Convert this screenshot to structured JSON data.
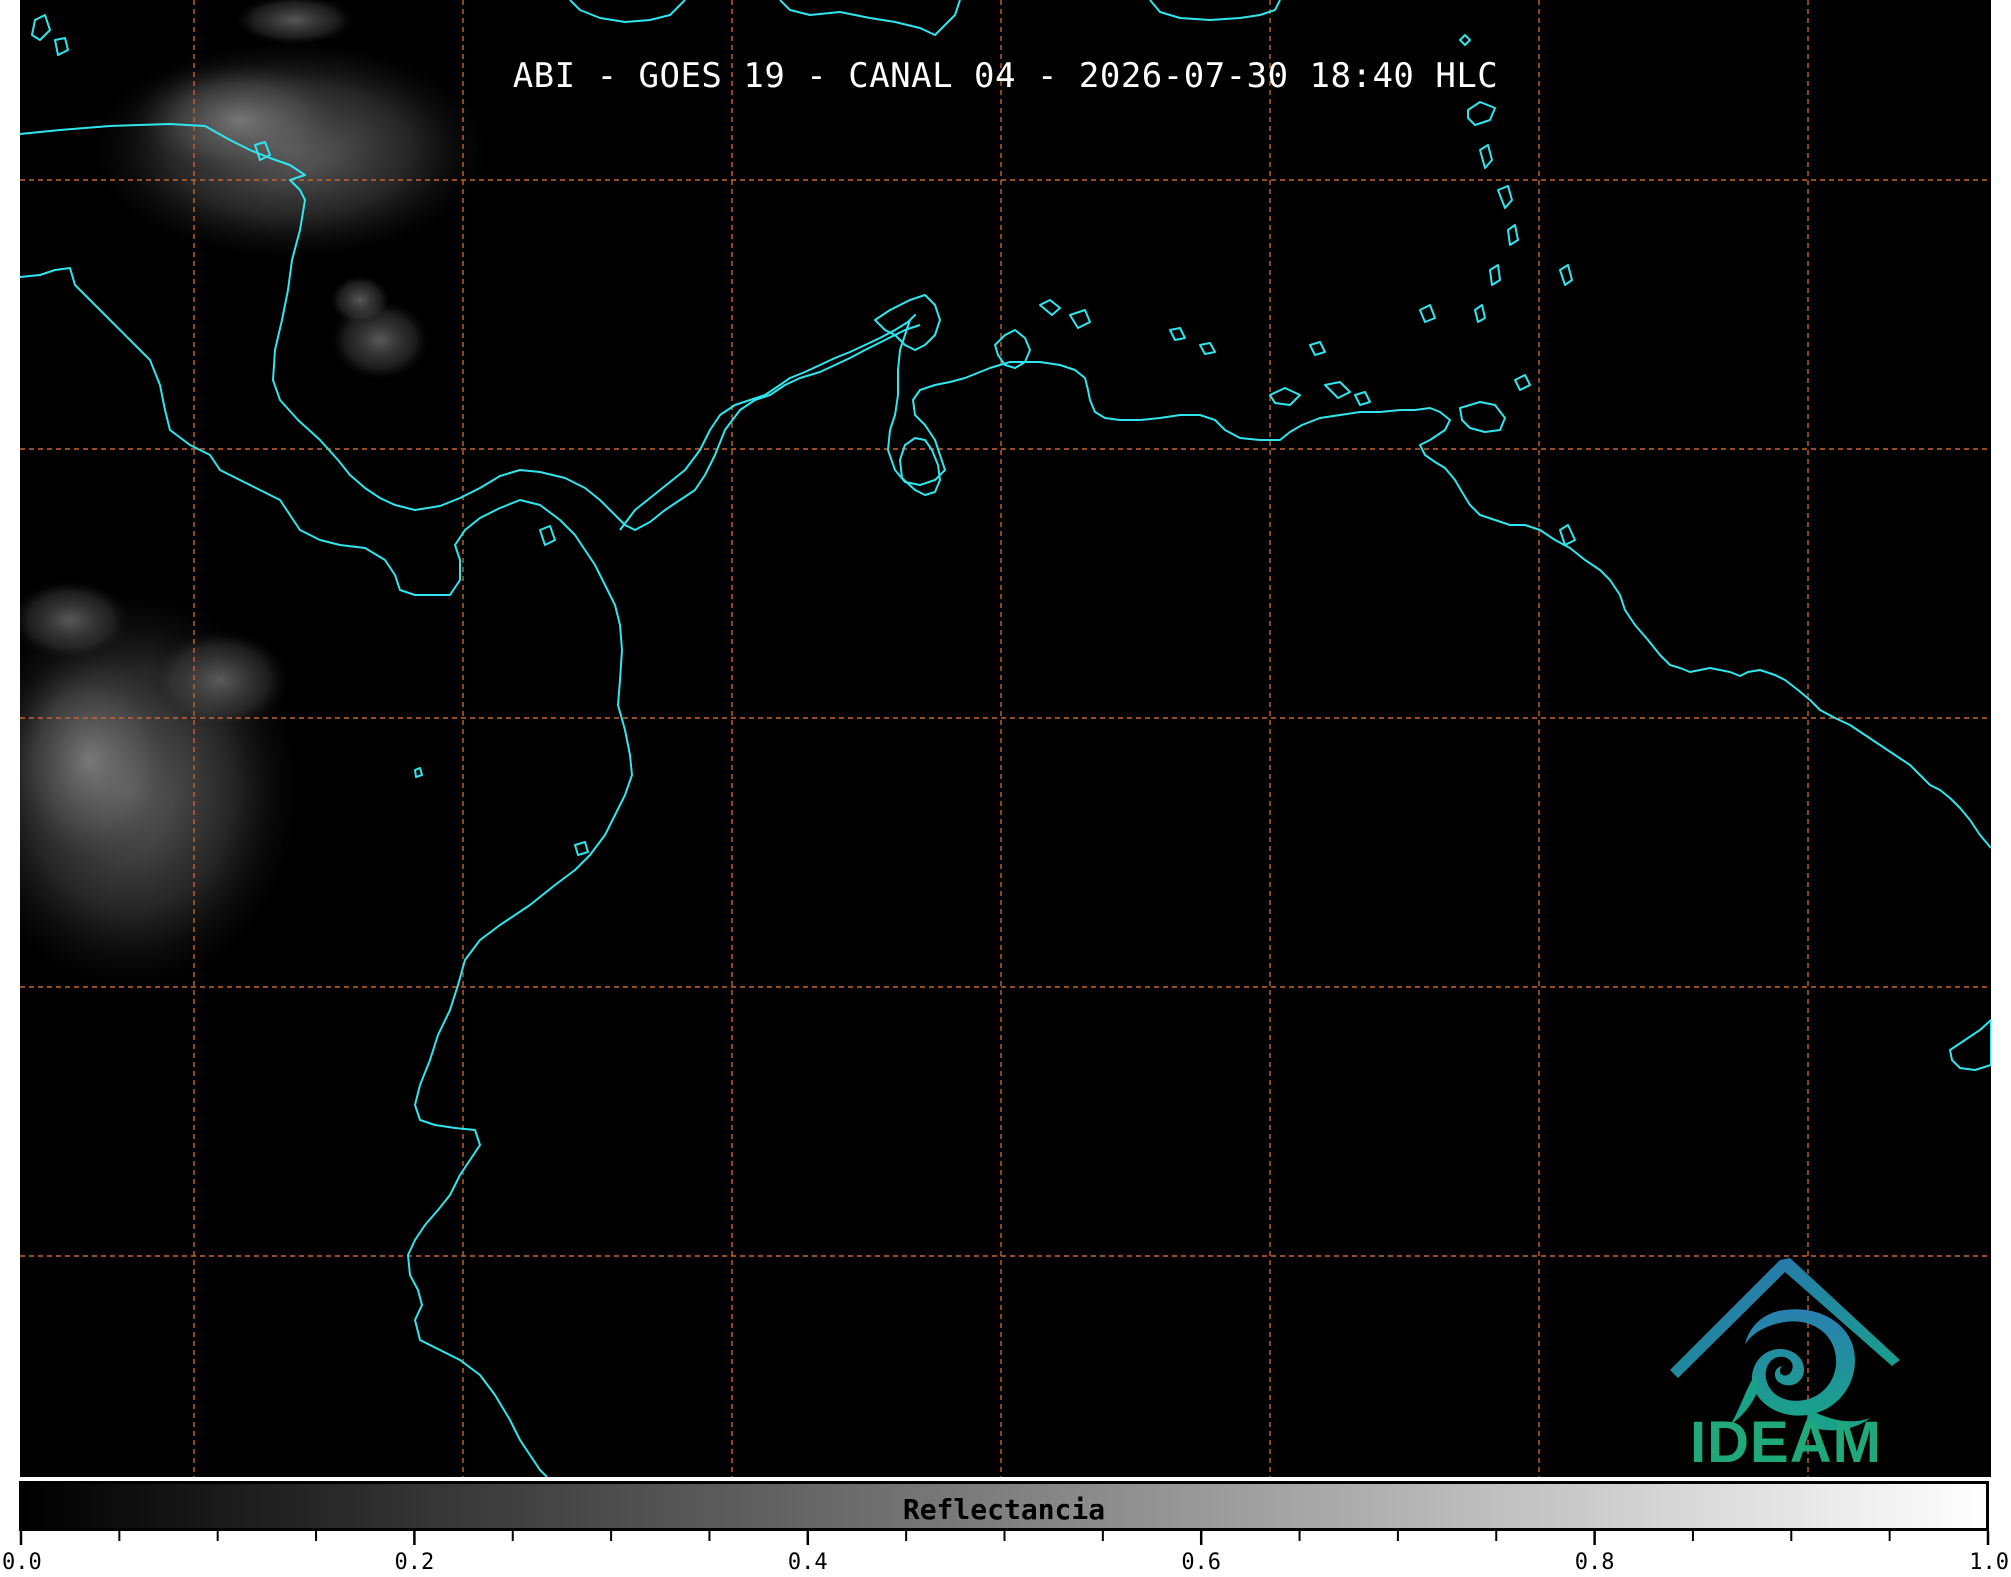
{
  "title": "ABI - GOES 19 - CANAL 04 - 2026-07-30 18:40 HLC",
  "colorbar": {
    "label": "Reflectancia",
    "range": [
      0.0,
      1.0
    ],
    "major_ticks": [
      0.0,
      0.2,
      0.4,
      0.6,
      0.8,
      1.0
    ],
    "tick_labels": [
      "0.0",
      "0.2",
      "0.4",
      "0.6",
      "0.8",
      "1.0"
    ],
    "minor_tick_step": 0.05,
    "colors": {
      "low": "#000000",
      "high": "#ffffff"
    }
  },
  "logo": {
    "text": "IDEAM",
    "colors": {
      "roof": "#2a6fb4",
      "swirl": "#1aa18a",
      "text": "#1fa97a"
    }
  },
  "map": {
    "background": "#000000",
    "coastline_color": "#2fe6ee",
    "graticule_color": "#c8642a",
    "graticule_style": "dashed",
    "imagery": "reflectancia"
  }
}
